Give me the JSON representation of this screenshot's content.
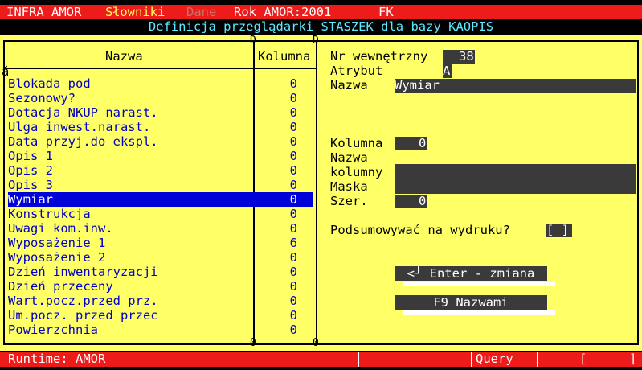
{
  "menu": {
    "app": "INFRA AMOR",
    "slowniki_hot": "S",
    "slowniki_rest": "łowniki",
    "dane": "Dane",
    "rok": "Rok AMOR:2001",
    "fk": "FK"
  },
  "title": "Definicja przeglądarki STASZEK dla bazy KAOPIS",
  "list": {
    "header_name": "Nazwa",
    "header_col": "Kolumna",
    "marker": "ă",
    "rows": [
      {
        "name": "Blokada pod",
        "value": "0"
      },
      {
        "name": "Sezonowy?",
        "value": "0"
      },
      {
        "name": "Dotacja NKUP narast.",
        "value": "0"
      },
      {
        "name": "Ulga inwest.narast.",
        "value": "0"
      },
      {
        "name": "Data przyj.do ekspl.",
        "value": "0"
      },
      {
        "name": "Opis 1",
        "value": "0"
      },
      {
        "name": "Opis 2",
        "value": "0"
      },
      {
        "name": "Opis 3",
        "value": "0"
      },
      {
        "name": "Wymiar",
        "value": "0"
      },
      {
        "name": "Konstrukcja",
        "value": "0"
      },
      {
        "name": "Uwagi kom.inw.",
        "value": "0"
      },
      {
        "name": "Wyposażenie 1",
        "value": "6"
      },
      {
        "name": "Wyposażenie 2",
        "value": "0"
      },
      {
        "name": "Dzień inwentaryzacji",
        "value": "0"
      },
      {
        "name": "Dzień przeceny",
        "value": "0"
      },
      {
        "name": "Wart.pocz.przed prz.",
        "value": "0"
      },
      {
        "name": "Um.pocz. przed przec",
        "value": "0"
      },
      {
        "name": "Powierzchnia",
        "value": "0"
      }
    ],
    "selected_index": 8
  },
  "form": {
    "nr_label": "Nr wewnętrzny",
    "nr_value": "38",
    "atrybut_label": "Atrybut",
    "atrybut_value": "A",
    "nazwa_label": "Nazwa",
    "nazwa_value": "Wymiar",
    "kolumna_label": "Kolumna",
    "kolumna_value": "0",
    "nazwa_kol_label1": "Nazwa",
    "nazwa_kol_label2": "kolumny",
    "nazwa_kol_value": "",
    "maska_label": "Maska",
    "maska_value": "",
    "szer_label": "Szer.",
    "szer_value": "0",
    "podsum_label": "Podsumowywać na wydruku?",
    "podsum_value": "[ ]",
    "btn_enter": "<┘ Enter - zmiana",
    "btn_f9": "F9 Nazwami"
  },
  "frame_marks": {
    "top": "D",
    "bottom": "0"
  },
  "status": {
    "runtime": "Runtime: AMOR",
    "query": "Query",
    "bracket": "[",
    "bracket_end": "]"
  },
  "colors": {
    "menu_bg": "#ee1b1b",
    "panel_bg": "#ffff66",
    "title_fg": "#5be8ff",
    "selection": "#0000d8",
    "field_bg": "#3a3a3a"
  }
}
